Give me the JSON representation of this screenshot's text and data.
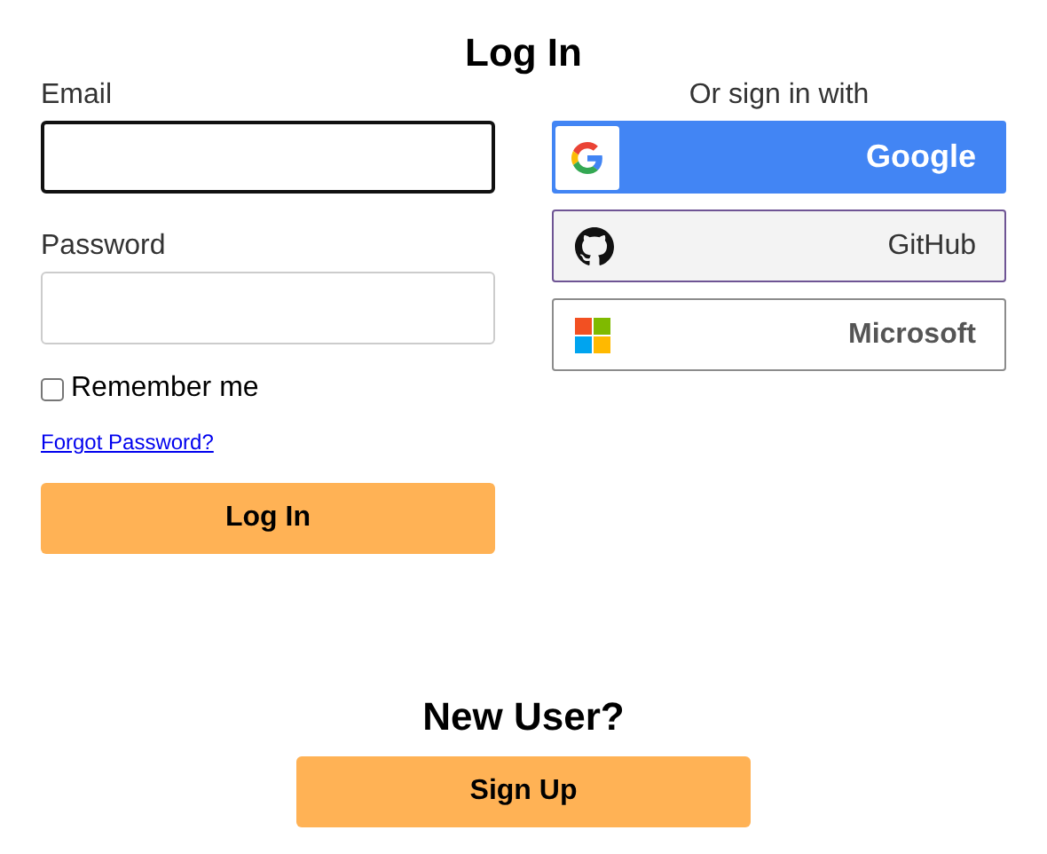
{
  "title": "Log In",
  "email": {
    "label": "Email",
    "focused": true
  },
  "password": {
    "label": "Password",
    "focused": false
  },
  "remember": {
    "label": "Remember me",
    "checked": false
  },
  "forgot_link": "Forgot Password?",
  "login_button": "Log In",
  "social": {
    "heading": "Or sign in with",
    "providers": [
      {
        "kind": "google",
        "label": "Google"
      },
      {
        "kind": "github",
        "label": "GitHub"
      },
      {
        "kind": "microsoft",
        "label": "Microsoft"
      }
    ]
  },
  "new_user": {
    "heading": "New User?",
    "button": "Sign Up"
  }
}
